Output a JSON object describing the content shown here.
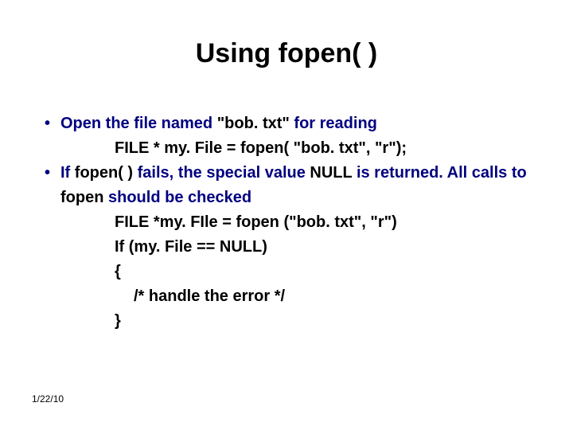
{
  "title": "Using fopen( )",
  "bullet1": {
    "prefix": "Open the file named ",
    "mid": "\"bob. txt\"",
    "suffix": " for reading"
  },
  "line_code1": "FILE * my. File = fopen( \"bob. txt\", \"r\");",
  "bullet2": {
    "p1": "If ",
    "p2": "fopen( )",
    "p3": " fails, the special value ",
    "p4": "NULL",
    "p5": " is returned. All calls to ",
    "p6": "fopen",
    "p7": " should be checked"
  },
  "line_code2": "FILE *my. FIle = fopen (\"bob. txt\", \"r\")",
  "line_code3": "If (my. File == NULL)",
  "line_code4": "{",
  "line_code5": "/* handle the error */",
  "line_code6": "}",
  "footer_date": "1/22/10",
  "bullet_char": "•"
}
